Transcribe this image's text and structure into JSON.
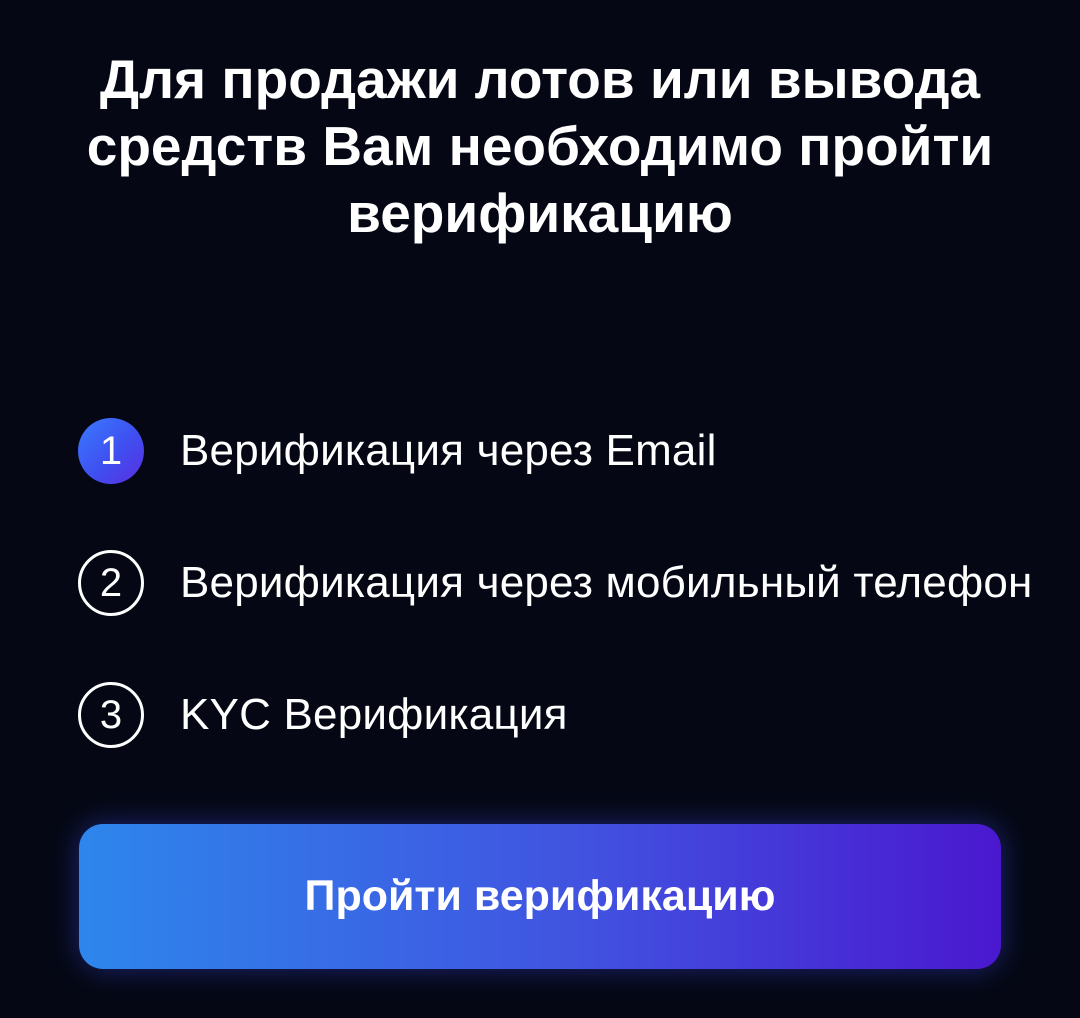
{
  "header": {
    "title_line1": "Для продажи лотов или вывода",
    "title_line2": "средств Вам необходимо пройти",
    "title_line3": "верификацию"
  },
  "steps": [
    {
      "number": "1",
      "label": "Верификация через Email",
      "state": "active"
    },
    {
      "number": "2",
      "label": "Верификация через мобильный телефон",
      "state": "inactive"
    },
    {
      "number": "3",
      "label": "KYC Верификация",
      "state": "inactive"
    }
  ],
  "cta": {
    "label": "Пройти верификацию"
  },
  "colors": {
    "background": "#050814",
    "accent_start": "#2e86ec",
    "accent_end": "#4a18cf",
    "text": "#ffffff"
  }
}
